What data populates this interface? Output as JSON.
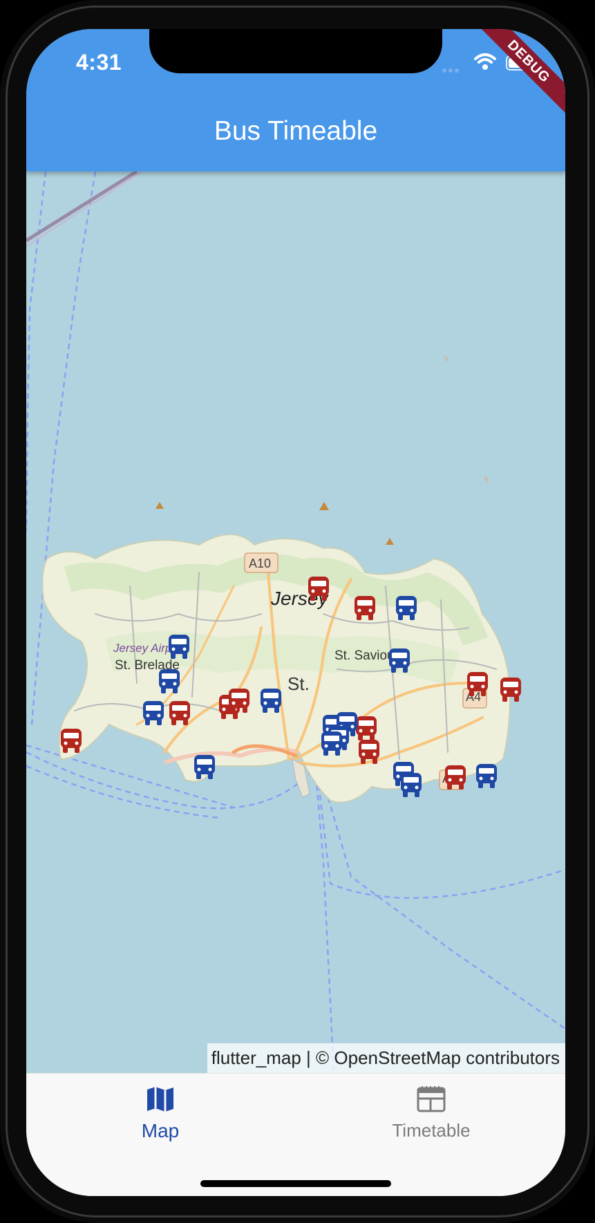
{
  "status_bar": {
    "time": "4:31"
  },
  "debug_banner": {
    "label": "DEBUG"
  },
  "app_bar": {
    "title": "Bus Timeable"
  },
  "map": {
    "place_labels": {
      "island": "Jersey",
      "road_a10": "A10",
      "airport": "Jersey Airport",
      "st_brelade": "St. Brelade",
      "st_saviour": "St. Saviour",
      "st_helier_partial": "St.",
      "road_a4_1": "A4",
      "road_a4_2": "A4"
    },
    "attribution": "flutter_map | © OpenStreetMap contributors",
    "marker_colors": {
      "red": "#b3261e",
      "blue": "#1e48a3"
    }
  },
  "bottom_nav": {
    "items": [
      {
        "label": "Map",
        "icon": "map-icon",
        "selected": true
      },
      {
        "label": "Timetable",
        "icon": "timetable-icon",
        "selected": false
      }
    ],
    "active_color": "#2149a8",
    "inactive_color": "#7b7b7b"
  }
}
